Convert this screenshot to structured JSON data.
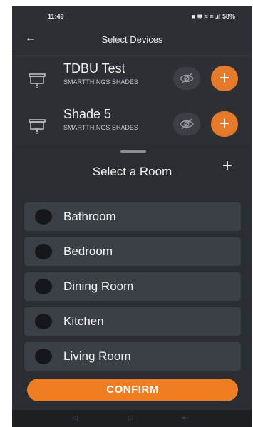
{
  "status_bar": {
    "time": "11:49",
    "indicators": "■ ✱ ≈ ≡ .ıl 58%"
  },
  "header": {
    "title": "Select Devices",
    "back_icon": "arrow-left-icon"
  },
  "devices": [
    {
      "name": "TDBU Test",
      "subtitle": "SMARTTHINGS SHADES",
      "icon": "shade-icon"
    },
    {
      "name": "Shade 5",
      "subtitle": "SMARTTHINGS SHADES",
      "icon": "shade-icon"
    }
  ],
  "sheet": {
    "title": "Select a Room",
    "add_label": "+"
  },
  "rooms": [
    {
      "label": "Bathroom"
    },
    {
      "label": "Bedroom"
    },
    {
      "label": "Dining Room"
    },
    {
      "label": "Kitchen"
    },
    {
      "label": "Living Room"
    }
  ],
  "confirm_label": "CONFIRM",
  "add_button_label": "+",
  "colors": {
    "accent": "#E47A2A",
    "background": "#2C2F33",
    "row_background": "#3B3F46"
  }
}
